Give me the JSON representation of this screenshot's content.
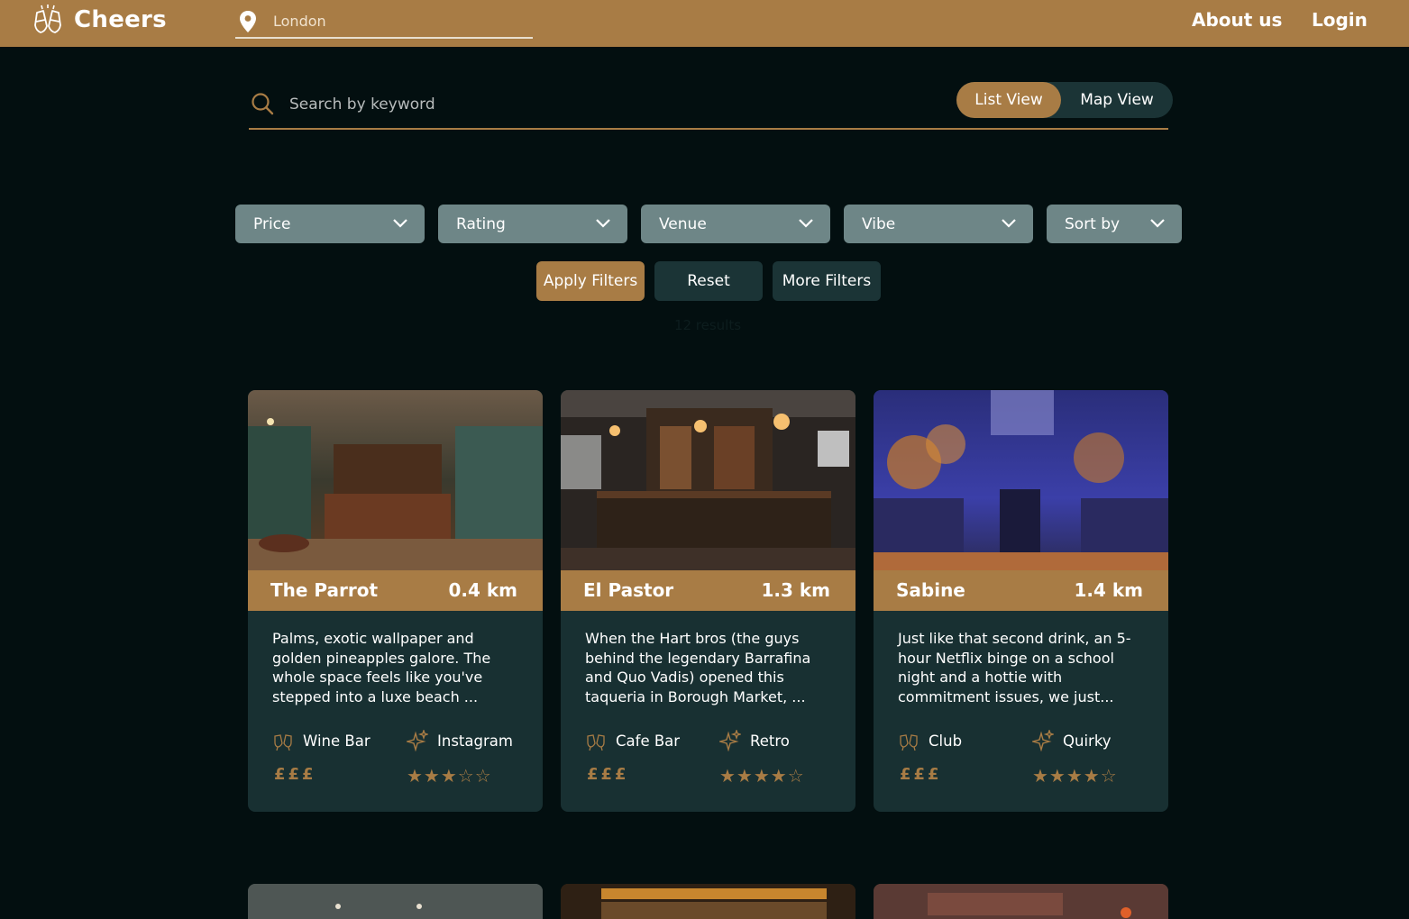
{
  "header": {
    "app_name": "Cheers",
    "location_placeholder": "London",
    "nav": {
      "about": "About us",
      "login": "Login"
    }
  },
  "search": {
    "placeholder": "Search by keyword",
    "view_toggle": {
      "list": "List View",
      "map": "Map View",
      "active": "list"
    }
  },
  "filters": {
    "dropdowns": [
      "Price",
      "Rating",
      "Venue",
      "Vibe",
      "Sort by"
    ],
    "apply": "Apply Filters",
    "reset": "Reset",
    "more": "More Filters"
  },
  "results": {
    "count_text": "12 results"
  },
  "cards": [
    {
      "name": "The Parrot",
      "distance": "0.4 km",
      "description": "Palms, exotic wallpaper and golden pineapples galore. The whole space feels like you've stepped into a luxe beach ...",
      "type": "Wine Bar",
      "vibe": "Instagram",
      "price": "£££",
      "stars": "★★★☆☆"
    },
    {
      "name": "El Pastor",
      "distance": "1.3 km",
      "description": "When the Hart bros (the guys behind the legendary Barrafina and Quo Vadis) opened this taqueria in Borough Market, ...",
      "type": "Cafe Bar",
      "vibe": "Retro",
      "price": "£££",
      "stars": "★★★★☆"
    },
    {
      "name": "Sabine",
      "distance": "1.4 km",
      "description": "Just like that second drink, an 5-hour Netflix binge on a school night and a hottie with commitment issues, we just...",
      "type": "Club",
      "vibe": "Quirky",
      "price": "£££",
      "stars": "★★★★☆"
    }
  ],
  "colors": {
    "brand": "#a87c45",
    "background": "#030f10",
    "card": "#183032",
    "filter": "#6e8687",
    "button_dark": "#1b3436"
  },
  "icons": {
    "logo": "cheers-glasses-icon",
    "location": "map-pin-icon",
    "search": "search-icon",
    "chevron": "chevron-down-icon",
    "venue_type": "glasses-icon",
    "vibe": "sparkle-icon"
  }
}
